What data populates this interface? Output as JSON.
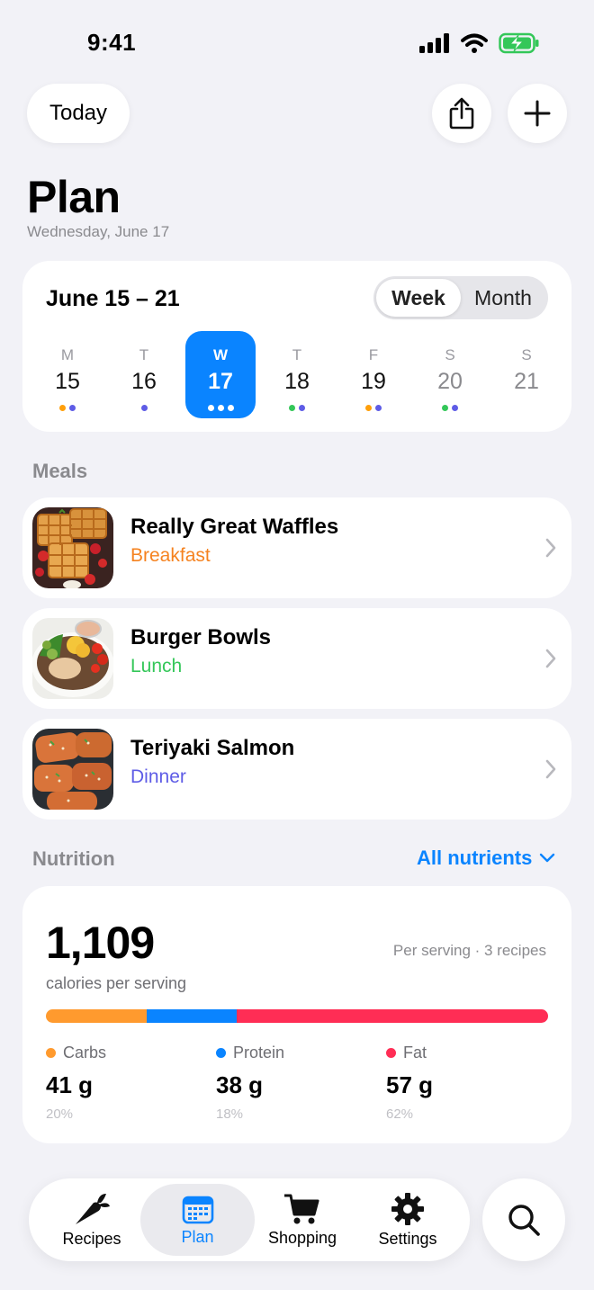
{
  "status": {
    "time": "9:41"
  },
  "header": {
    "today_label": "Today",
    "title": "Plan",
    "subtitle": "Wednesday, June 17"
  },
  "calendar": {
    "range": "June 15 – 21",
    "view_options": [
      "Week",
      "Month"
    ],
    "selected_view": "Week",
    "days": [
      {
        "letter": "M",
        "num": "15",
        "dots": [
          "#ff9f0a",
          "#5e5ce6"
        ]
      },
      {
        "letter": "T",
        "num": "16",
        "dots": [
          "#5e5ce6"
        ]
      },
      {
        "letter": "W",
        "num": "17",
        "dots": [
          "#ffffff",
          "#ffffff",
          "#ffffff"
        ],
        "selected": true
      },
      {
        "letter": "T",
        "num": "18",
        "dots": [
          "#34c759",
          "#5e5ce6"
        ]
      },
      {
        "letter": "F",
        "num": "19",
        "dots": [
          "#ff9f0a",
          "#5e5ce6"
        ]
      },
      {
        "letter": "S",
        "num": "20",
        "dots": [
          "#34c759",
          "#5e5ce6"
        ],
        "future": true
      },
      {
        "letter": "S",
        "num": "21",
        "dots": [],
        "future": true
      }
    ]
  },
  "meals": {
    "heading": "Meals",
    "items": [
      {
        "name": "Really Great Waffles",
        "type": "Breakfast",
        "type_color": "#f5821f"
      },
      {
        "name": "Burger Bowls",
        "type": "Lunch",
        "type_color": "#34c759"
      },
      {
        "name": "Teriyaki Salmon",
        "type": "Dinner",
        "type_color": "#5e5ce6"
      }
    ]
  },
  "nutrition": {
    "heading": "Nutrition",
    "filter_label": "All nutrients",
    "calories": "1,109",
    "calories_label": "calories per serving",
    "note": "Per serving · 3 recipes",
    "macros": [
      {
        "name": "Carbs",
        "value": "41 g",
        "percent": "20%",
        "fraction": 0.2,
        "color": "#ff9a2e"
      },
      {
        "name": "Protein",
        "value": "38 g",
        "percent": "18%",
        "fraction": 0.18,
        "color": "#0a84ff"
      },
      {
        "name": "Fat",
        "value": "57 g",
        "percent": "62%",
        "fraction": 0.62,
        "color": "#ff2d55"
      }
    ]
  },
  "tabbar": {
    "tabs": [
      {
        "label": "Recipes",
        "icon": "carrot-icon"
      },
      {
        "label": "Plan",
        "icon": "calendar-icon",
        "active": true
      },
      {
        "label": "Shopping",
        "icon": "cart-icon"
      },
      {
        "label": "Settings",
        "icon": "gear-icon"
      }
    ],
    "search_icon": "magnifier-icon"
  },
  "colors": {
    "accent": "#0a84ff",
    "background": "#f2f2f7"
  }
}
